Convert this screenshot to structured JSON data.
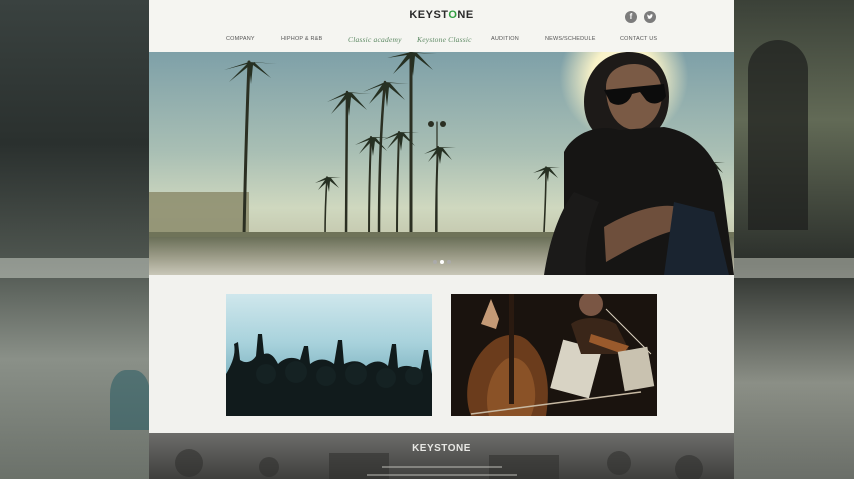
{
  "logo": {
    "text_main": "KEYST",
    "text_accent": "O",
    "text_end": "NE"
  },
  "social": {
    "facebook": "f",
    "twitter": "t"
  },
  "nav": [
    {
      "label": "COMPANY"
    },
    {
      "label": "HIPHOP & R&B"
    },
    {
      "label": "Classic academy"
    },
    {
      "label": "Keystone Classic"
    },
    {
      "label": "AUDITION"
    },
    {
      "label": "NEWS/SCHEDULE"
    },
    {
      "label": "CONTACT US"
    }
  ],
  "footer": {
    "logo": "KEYSTONE"
  },
  "colors": {
    "accent": "#2f9e3f",
    "script_nav": "#5e8a64",
    "footer_bg": "#4a4a48"
  },
  "slider": {
    "total": 3,
    "active": 2
  }
}
